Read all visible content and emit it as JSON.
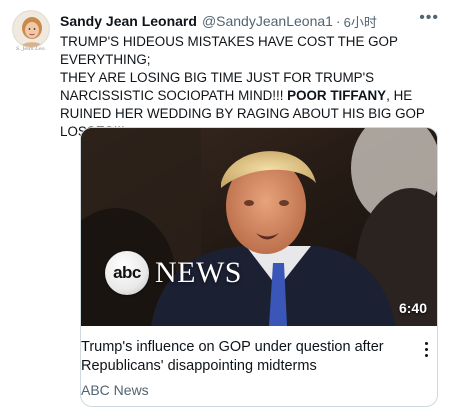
{
  "tweet": {
    "author_name": "Sandy Jean Leonard",
    "author_handle": "@SandyJeanLeona1",
    "separator": "·",
    "time": "6小时",
    "avatar_caption": "S. Jean Leo.",
    "text_part1": "TRUMP'S HIDEOUS MISTAKES HAVE COST THE GOP EVERYTHING;",
    "text_part2": "THEY ARE LOSING BIG TIME JUST FOR TRUMP'S NARCISSISTIC SOCIOPATH MIND!!! ",
    "text_bold": "POOR TIFFANY",
    "text_part3": ", HE RUINED HER WEDDING BY RAGING ABOUT HIS BIG GOP LOSSES!!!",
    "more_icon": "more-horizontal-icon"
  },
  "card": {
    "logo_abc": "abc",
    "logo_news": "NEWS",
    "duration": "6:40",
    "title": "Trump's influence on GOP under question after Republicans' disappointing midterms",
    "source": "ABC News",
    "menu_icon": "more-vertical-icon"
  },
  "colors": {
    "text": "#0f1419",
    "secondary": "#536471",
    "border": "#cfd9de"
  }
}
